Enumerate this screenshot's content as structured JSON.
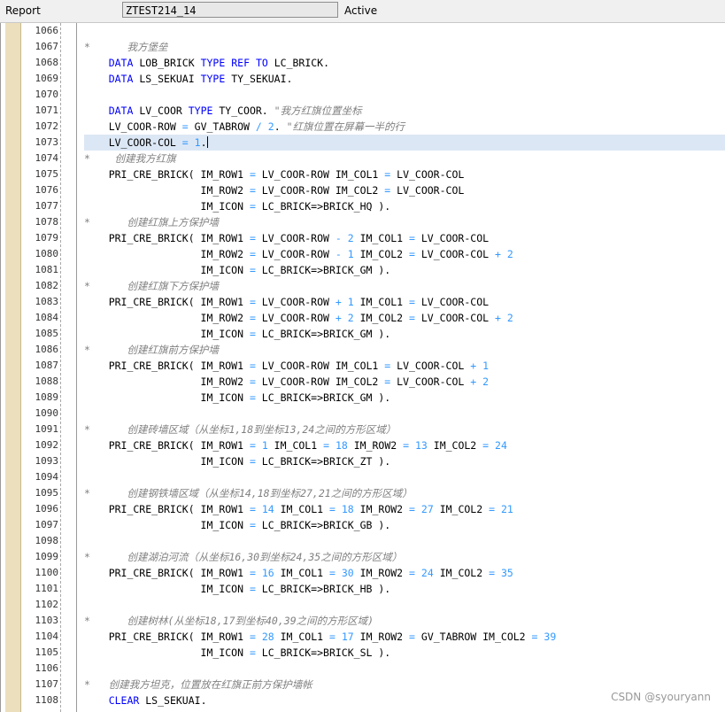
{
  "header": {
    "label": "Report",
    "program": "ZTEST214_14",
    "status": "Active"
  },
  "watermark": "CSDN @syouryann",
  "lines": [
    {
      "n": "1066",
      "t": []
    },
    {
      "n": "1067",
      "t": [
        [
          "*      我方堡垒",
          "cmt"
        ]
      ]
    },
    {
      "n": "1068",
      "t": [
        [
          "    "
        ],
        [
          "DATA",
          "kw"
        ],
        [
          " LOB_BRICK "
        ],
        [
          "TYPE",
          "kw"
        ],
        [
          " "
        ],
        [
          "REF",
          "kw"
        ],
        [
          " "
        ],
        [
          "TO",
          "kw"
        ],
        [
          " LC_BRICK."
        ]
      ]
    },
    {
      "n": "1069",
      "t": [
        [
          "    "
        ],
        [
          "DATA",
          "kw"
        ],
        [
          " LS_SEKUAI "
        ],
        [
          "TYPE",
          "kw"
        ],
        [
          " TY_SEKUAI."
        ]
      ]
    },
    {
      "n": "1070",
      "t": []
    },
    {
      "n": "1071",
      "t": [
        [
          "    "
        ],
        [
          "DATA",
          "kw"
        ],
        [
          " LV_COOR "
        ],
        [
          "TYPE",
          "kw"
        ],
        [
          " TY_COOR. "
        ],
        [
          "\"我方红旗位置坐标",
          "cmt"
        ]
      ]
    },
    {
      "n": "1072",
      "t": [
        [
          "    LV_COOR-ROW "
        ],
        [
          "=",
          "op"
        ],
        [
          " GV_TABROW "
        ],
        [
          "/",
          "op"
        ],
        [
          " "
        ],
        [
          "2",
          "num"
        ],
        [
          ". "
        ],
        [
          "\"红旗位置在屏幕一半的行",
          "cmt"
        ]
      ]
    },
    {
      "n": "1073",
      "cur": true,
      "t": [
        [
          "    LV_COOR-COL "
        ],
        [
          "=",
          "op"
        ],
        [
          " "
        ],
        [
          "1",
          "num"
        ],
        [
          "."
        ]
      ]
    },
    {
      "n": "1074",
      "t": [
        [
          "*    创建我方红旗",
          "cmt"
        ]
      ]
    },
    {
      "n": "1075",
      "t": [
        [
          "    PRI_CRE_BRICK( IM_ROW1 "
        ],
        [
          "=",
          "op"
        ],
        [
          " LV_COOR-ROW IM_COL1 "
        ],
        [
          "=",
          "op"
        ],
        [
          " LV_COOR-COL"
        ]
      ]
    },
    {
      "n": "1076",
      "t": [
        [
          "                   IM_ROW2 "
        ],
        [
          "=",
          "op"
        ],
        [
          " LV_COOR-ROW IM_COL2 "
        ],
        [
          "=",
          "op"
        ],
        [
          " LV_COOR-COL"
        ]
      ]
    },
    {
      "n": "1077",
      "t": [
        [
          "                   IM_ICON "
        ],
        [
          "=",
          "op"
        ],
        [
          " LC_BRICK=>BRICK_HQ )."
        ]
      ]
    },
    {
      "n": "1078",
      "t": [
        [
          "*      创建红旗上方保护墙",
          "cmt"
        ]
      ]
    },
    {
      "n": "1079",
      "t": [
        [
          "    PRI_CRE_BRICK( IM_ROW1 "
        ],
        [
          "=",
          "op"
        ],
        [
          " LV_COOR-ROW "
        ],
        [
          "-",
          "op"
        ],
        [
          " "
        ],
        [
          "2",
          "num"
        ],
        [
          " IM_COL1 "
        ],
        [
          "=",
          "op"
        ],
        [
          " LV_COOR-COL"
        ]
      ]
    },
    {
      "n": "1080",
      "t": [
        [
          "                   IM_ROW2 "
        ],
        [
          "=",
          "op"
        ],
        [
          " LV_COOR-ROW "
        ],
        [
          "-",
          "op"
        ],
        [
          " "
        ],
        [
          "1",
          "num"
        ],
        [
          " IM_COL2 "
        ],
        [
          "=",
          "op"
        ],
        [
          " LV_COOR-COL "
        ],
        [
          "+",
          "op"
        ],
        [
          " "
        ],
        [
          "2",
          "num"
        ]
      ]
    },
    {
      "n": "1081",
      "t": [
        [
          "                   IM_ICON "
        ],
        [
          "=",
          "op"
        ],
        [
          " LC_BRICK=>BRICK_GM )."
        ]
      ]
    },
    {
      "n": "1082",
      "t": [
        [
          "*      创建红旗下方保护墙",
          "cmt"
        ]
      ]
    },
    {
      "n": "1083",
      "t": [
        [
          "    PRI_CRE_BRICK( IM_ROW1 "
        ],
        [
          "=",
          "op"
        ],
        [
          " LV_COOR-ROW "
        ],
        [
          "+",
          "op"
        ],
        [
          " "
        ],
        [
          "1",
          "num"
        ],
        [
          " IM_COL1 "
        ],
        [
          "=",
          "op"
        ],
        [
          " LV_COOR-COL"
        ]
      ]
    },
    {
      "n": "1084",
      "t": [
        [
          "                   IM_ROW2 "
        ],
        [
          "=",
          "op"
        ],
        [
          " LV_COOR-ROW "
        ],
        [
          "+",
          "op"
        ],
        [
          " "
        ],
        [
          "2",
          "num"
        ],
        [
          " IM_COL2 "
        ],
        [
          "=",
          "op"
        ],
        [
          " LV_COOR-COL "
        ],
        [
          "+",
          "op"
        ],
        [
          " "
        ],
        [
          "2",
          "num"
        ]
      ]
    },
    {
      "n": "1085",
      "t": [
        [
          "                   IM_ICON "
        ],
        [
          "=",
          "op"
        ],
        [
          " LC_BRICK=>BRICK_GM )."
        ]
      ]
    },
    {
      "n": "1086",
      "t": [
        [
          "*      创建红旗前方保护墙",
          "cmt"
        ]
      ]
    },
    {
      "n": "1087",
      "t": [
        [
          "    PRI_CRE_BRICK( IM_ROW1 "
        ],
        [
          "=",
          "op"
        ],
        [
          " LV_COOR-ROW IM_COL1 "
        ],
        [
          "=",
          "op"
        ],
        [
          " LV_COOR-COL "
        ],
        [
          "+",
          "op"
        ],
        [
          " "
        ],
        [
          "1",
          "num"
        ]
      ]
    },
    {
      "n": "1088",
      "t": [
        [
          "                   IM_ROW2 "
        ],
        [
          "=",
          "op"
        ],
        [
          " LV_COOR-ROW IM_COL2 "
        ],
        [
          "=",
          "op"
        ],
        [
          " LV_COOR-COL "
        ],
        [
          "+",
          "op"
        ],
        [
          " "
        ],
        [
          "2",
          "num"
        ]
      ]
    },
    {
      "n": "1089",
      "t": [
        [
          "                   IM_ICON "
        ],
        [
          "=",
          "op"
        ],
        [
          " LC_BRICK=>BRICK_GM )."
        ]
      ]
    },
    {
      "n": "1090",
      "t": []
    },
    {
      "n": "1091",
      "t": [
        [
          "*      创建砖墙区域（从坐标1,18到坐标13,24之间的方形区域）",
          "cmt"
        ]
      ]
    },
    {
      "n": "1092",
      "t": [
        [
          "    PRI_CRE_BRICK( IM_ROW1 "
        ],
        [
          "=",
          "op"
        ],
        [
          " "
        ],
        [
          "1",
          "num"
        ],
        [
          " IM_COL1 "
        ],
        [
          "=",
          "op"
        ],
        [
          " "
        ],
        [
          "18",
          "num"
        ],
        [
          " IM_ROW2 "
        ],
        [
          "=",
          "op"
        ],
        [
          " "
        ],
        [
          "13",
          "num"
        ],
        [
          " IM_COL2 "
        ],
        [
          "=",
          "op"
        ],
        [
          " "
        ],
        [
          "24",
          "num"
        ]
      ]
    },
    {
      "n": "1093",
      "t": [
        [
          "                   IM_ICON "
        ],
        [
          "=",
          "op"
        ],
        [
          " LC_BRICK=>BRICK_ZT )."
        ]
      ]
    },
    {
      "n": "1094",
      "t": []
    },
    {
      "n": "1095",
      "t": [
        [
          "*      创建钢铁墙区域（从坐标14,18到坐标27,21之间的方形区域）",
          "cmt"
        ]
      ]
    },
    {
      "n": "1096",
      "t": [
        [
          "    PRI_CRE_BRICK( IM_ROW1 "
        ],
        [
          "=",
          "op"
        ],
        [
          " "
        ],
        [
          "14",
          "num"
        ],
        [
          " IM_COL1 "
        ],
        [
          "=",
          "op"
        ],
        [
          " "
        ],
        [
          "18",
          "num"
        ],
        [
          " IM_ROW2 "
        ],
        [
          "=",
          "op"
        ],
        [
          " "
        ],
        [
          "27",
          "num"
        ],
        [
          " IM_COL2 "
        ],
        [
          "=",
          "op"
        ],
        [
          " "
        ],
        [
          "21",
          "num"
        ]
      ]
    },
    {
      "n": "1097",
      "t": [
        [
          "                   IM_ICON "
        ],
        [
          "=",
          "op"
        ],
        [
          " LC_BRICK=>BRICK_GB )."
        ]
      ]
    },
    {
      "n": "1098",
      "t": []
    },
    {
      "n": "1099",
      "t": [
        [
          "*      创建湖泊河流（从坐标16,30到坐标24,35之间的方形区域）",
          "cmt"
        ]
      ]
    },
    {
      "n": "1100",
      "t": [
        [
          "    PRI_CRE_BRICK( IM_ROW1 "
        ],
        [
          "=",
          "op"
        ],
        [
          " "
        ],
        [
          "16",
          "num"
        ],
        [
          " IM_COL1 "
        ],
        [
          "=",
          "op"
        ],
        [
          " "
        ],
        [
          "30",
          "num"
        ],
        [
          " IM_ROW2 "
        ],
        [
          "=",
          "op"
        ],
        [
          " "
        ],
        [
          "24",
          "num"
        ],
        [
          " IM_COL2 "
        ],
        [
          "=",
          "op"
        ],
        [
          " "
        ],
        [
          "35",
          "num"
        ]
      ]
    },
    {
      "n": "1101",
      "t": [
        [
          "                   IM_ICON "
        ],
        [
          "=",
          "op"
        ],
        [
          " LC_BRICK=>BRICK_HB )."
        ]
      ]
    },
    {
      "n": "1102",
      "t": []
    },
    {
      "n": "1103",
      "t": [
        [
          "*      创建树林(从坐标18,17到坐标40,39之间的方形区域)",
          "cmt"
        ]
      ]
    },
    {
      "n": "1104",
      "t": [
        [
          "    PRI_CRE_BRICK( IM_ROW1 "
        ],
        [
          "=",
          "op"
        ],
        [
          " "
        ],
        [
          "28",
          "num"
        ],
        [
          " IM_COL1 "
        ],
        [
          "=",
          "op"
        ],
        [
          " "
        ],
        [
          "17",
          "num"
        ],
        [
          " IM_ROW2 "
        ],
        [
          "=",
          "op"
        ],
        [
          " GV_TABROW IM_COL2 "
        ],
        [
          "=",
          "op"
        ],
        [
          " "
        ],
        [
          "39",
          "num"
        ]
      ]
    },
    {
      "n": "1105",
      "t": [
        [
          "                   IM_ICON "
        ],
        [
          "=",
          "op"
        ],
        [
          " LC_BRICK=>BRICK_SL )."
        ]
      ]
    },
    {
      "n": "1106",
      "t": []
    },
    {
      "n": "1107",
      "t": [
        [
          "*   创建我方坦克，位置放在红旗正前方保护墙帐",
          "cmt"
        ]
      ]
    },
    {
      "n": "1108",
      "t": [
        [
          "    "
        ],
        [
          "CLEAR",
          "kw"
        ],
        [
          " LS_SEKUAI."
        ]
      ]
    }
  ]
}
